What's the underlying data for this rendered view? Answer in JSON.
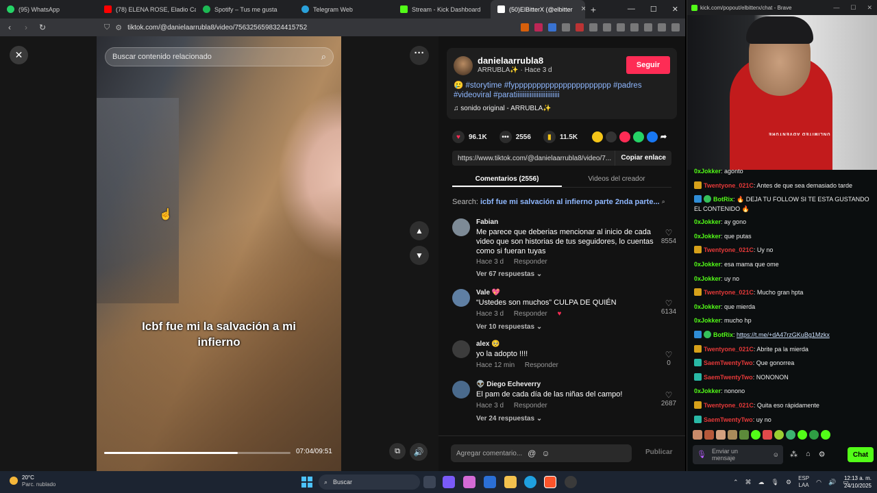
{
  "browser_tabs": [
    {
      "label": "(95) WhatsApp",
      "color": "#25d366"
    },
    {
      "label": "(78) ELENA ROSE, Eladio Carrió",
      "color": "#ff0000"
    },
    {
      "label": "Spotify – Tus me gusta",
      "color": "#1db954"
    },
    {
      "label": "Telegram Web",
      "color": "#2aa1da"
    },
    {
      "label": "Stream - Kick Dashboard",
      "color": "#53fc18"
    },
    {
      "label": "(50)ElBitterX (@elbitter",
      "color": "#ffffff"
    }
  ],
  "address": {
    "url": "tiktok.com/@danielaarrubla8/video/7563256598324415752"
  },
  "video": {
    "search_placeholder": "Buscar contenido relacionado",
    "caption": "Icbf fue mi la salvación a mi infierno",
    "time": "07:04/09:51",
    "progress": 0.718
  },
  "author": {
    "username": "danielaarrubla8",
    "subtitle": "ARRUBLA✨ · Hace 3 d",
    "follow_label": "Seguir"
  },
  "description": {
    "emoji": "🥲",
    "tags": "#storytime #fypppppppppppppppppppppp #padres #videoviral #paratiiiiiiiiiiiiiiiiiiiiiiiii",
    "sound": "♫  sonido original - ARRUBLA✨"
  },
  "stats": {
    "likes": "96.1K",
    "comments": "2556",
    "saves": "11.5K"
  },
  "link": {
    "url": "https://www.tiktok.com/@danielaarrubla8/video/7...",
    "copy_label": "Copiar enlace"
  },
  "panel_tabs": [
    "Comentarios (2556)",
    "Videos del creador"
  ],
  "search_line": {
    "prefix": "Search:",
    "query": "icbf fue mi salvación al infierno parte 2nda parte..."
  },
  "comments": [
    {
      "name": "Fabian",
      "text": "Me parece que deberias mencionar al inicio de cada video que son historias de tus seguidores, lo cuentas como si fueran tuyas",
      "time": "Hace 3 d",
      "reply": "Responder",
      "likes": "8554",
      "more": "Ver 67 respuestas ⌄",
      "avatar": "#7d8a96"
    },
    {
      "name": "Vale 💖",
      "text": "“Ustedes son muchos” CULPA DE QUIÉN",
      "time": "Hace 3 d",
      "reply": "Responder",
      "likes": "6134",
      "more": "Ver 10 respuestas ⌄",
      "avatar": "#5f7fa3"
    },
    {
      "name": "alex 🥺",
      "text": "yo la adopto !!!!",
      "time": "Hace 12 min",
      "reply": "Responder",
      "likes": "0",
      "more": "",
      "avatar": "#3c3c3c"
    },
    {
      "name": "👽 Diego Echeverry",
      "text": "El pam de cada día de las niñas del campo!",
      "time": "Hace 3 d",
      "reply": "Responder",
      "likes": "2687",
      "more": "Ver 24 respuestas ⌄",
      "avatar": "#4a6a8c"
    }
  ],
  "comment_bar": {
    "placeholder": "Agregar comentario...",
    "publish_label": "Publicar"
  },
  "kick": {
    "window_title": "kick.com/popout/elbitterx/chat - Brave",
    "shirt_text": "UNLIMITED ADVENTURE",
    "messages": [
      {
        "badge": "",
        "user": "0xJokker",
        "ucolor": "green",
        "text": ": agonto"
      },
      {
        "badge": "gold",
        "user": "Twentyone_021C",
        "ucolor": "red",
        "text": ": Antes de que sea demasiado tarde"
      },
      {
        "badge": "blue",
        "user": "BotRix",
        "ucolor": "green",
        "text": ": 🔥 DEJA TU FOLLOW SI TE ESTA GUSTANDO EL CONTENIDO 🔥",
        "wrap": true
      },
      {
        "badge": "",
        "user": "0xJokker",
        "ucolor": "green",
        "text": ": ay gono"
      },
      {
        "badge": "",
        "user": "0xJokker",
        "ucolor": "green",
        "text": ": que putas"
      },
      {
        "badge": "gold",
        "user": "Twentyone_021C",
        "ucolor": "red",
        "text": ": Uy no"
      },
      {
        "badge": "",
        "user": "0xJokker",
        "ucolor": "green",
        "text": ": esa mama que ome"
      },
      {
        "badge": "",
        "user": "0xJokker",
        "ucolor": "green",
        "text": ": uy no"
      },
      {
        "badge": "gold",
        "user": "Twentyone_021C",
        "ucolor": "red",
        "text": ": Mucho gran hpta"
      },
      {
        "badge": "",
        "user": "0xJokker",
        "ucolor": "green",
        "text": ": que mierda"
      },
      {
        "badge": "",
        "user": "0xJokker",
        "ucolor": "green",
        "text": ": mucho hp"
      },
      {
        "badge": "blue",
        "user": "BotRix",
        "ucolor": "green",
        "text": ": ",
        "link": "https://t.me/+dA47rzGKuBg1Mzkx"
      },
      {
        "badge": "gold",
        "user": "Twentyone_021C",
        "ucolor": "red",
        "text": ": Abrite pa la mierda"
      },
      {
        "badge": "teal",
        "user": "SaemTwentyTwo",
        "ucolor": "red",
        "text": ": Que gonorrea"
      },
      {
        "badge": "teal",
        "user": "SaemTwentyTwo",
        "ucolor": "red",
        "text": ": NONONON"
      },
      {
        "badge": "",
        "user": "0xJokker",
        "ucolor": "green",
        "text": ": nonono"
      },
      {
        "badge": "gold",
        "user": "Twentyone_021C",
        "ucolor": "red",
        "text": ": Quita eso rápidamente"
      },
      {
        "badge": "teal",
        "user": "SaemTwentyTwo",
        "ucolor": "red",
        "text": ": uy no"
      }
    ],
    "input_placeholder": "Enviar un mensaje",
    "send_label": "Chat"
  },
  "taskbar": {
    "weather_temp": "20°C",
    "weather_desc": "Parc. nublado",
    "search_label": "Buscar",
    "lang_top": "ESP",
    "lang_bottom": "LAA",
    "time": "12:13 a. m.",
    "date": "24/10/2025"
  }
}
